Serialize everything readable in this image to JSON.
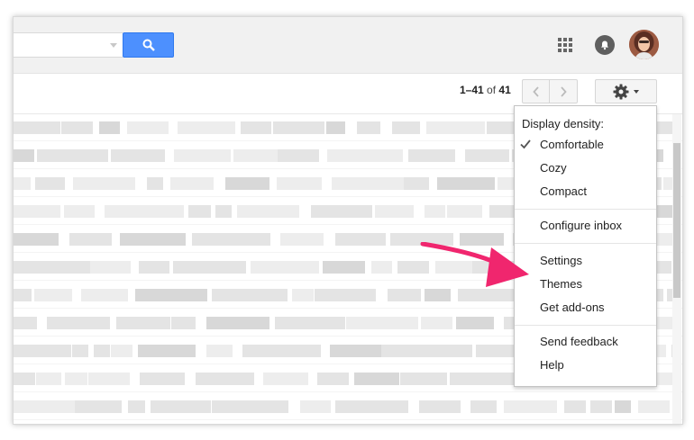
{
  "pager": {
    "range": "1–41",
    "of_label": "of",
    "total": "41"
  },
  "icons": {
    "search": "search-icon",
    "apps": "apps-grid-icon",
    "notifications": "bell-icon",
    "avatar": "avatar",
    "prev": "chevron-left-icon",
    "next": "chevron-right-icon",
    "settings": "gear-icon",
    "check": "check-icon"
  },
  "menu": {
    "heading": "Display density:",
    "density": [
      "Comfortable",
      "Cozy",
      "Compact"
    ],
    "selected_density": "Comfortable",
    "configure": "Configure inbox",
    "settings": "Settings",
    "themes": "Themes",
    "addons": "Get add-ons",
    "feedback": "Send feedback",
    "help": "Help"
  },
  "colors": {
    "search_button": "#4d90fe",
    "annotation_arrow": "#f0266e",
    "header_bg": "#f1f1f1"
  }
}
